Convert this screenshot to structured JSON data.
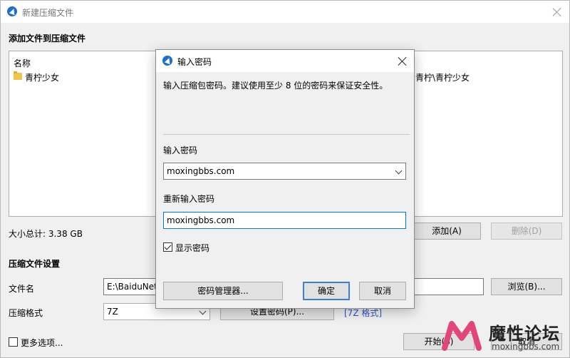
{
  "main": {
    "title": "新建压缩文件",
    "section_add": "添加文件到压缩文件",
    "list": {
      "column_name": "名称",
      "items": [
        {
          "name": "青柠少女",
          "path": "青柠\\青柠少女"
        }
      ]
    },
    "total_size": "大小总计: 3.38 GB",
    "add_button": "添加(A)",
    "delete_button": "删除(D)",
    "section_settings": "压缩文件设置",
    "filename_label": "文件名",
    "filename_value": "E:\\BaiduNet",
    "browse_button": "浏览(B)...",
    "format_label": "压缩格式",
    "format_value": "7Z",
    "set_password_button": "设置密码(P)...",
    "format_link": "[7Z 格式]",
    "more_options": "更多选项...",
    "start_button": "开始(S)",
    "cancel_button": "取消"
  },
  "dialog": {
    "title": "输入密码",
    "hint": "输入压缩包密码。建议使用至少 8 位的密码来保证安全性。",
    "password_label": "输入密码",
    "password_value": "moxingbbs.com",
    "confirm_label": "重新输入密码",
    "confirm_value": "moxingbbs.com",
    "show_password": "显示密码",
    "show_password_checked": true,
    "manager_button": "密码管理器...",
    "ok_button": "确定",
    "cancel_button": "取消"
  },
  "watermark": {
    "cn": "魔性论坛",
    "url": "moxingbbs.com"
  }
}
